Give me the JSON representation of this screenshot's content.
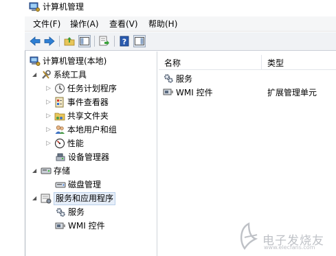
{
  "window": {
    "title": "计算机管理"
  },
  "menu": [
    "文件(F)",
    "操作(A)",
    "查看(V)",
    "帮助(H)"
  ],
  "tree": {
    "root": "计算机管理(本地)",
    "system_tools": "系统工具",
    "task_scheduler": "任务计划程序",
    "event_viewer": "事件查看器",
    "shared_folders": "共享文件夹",
    "local_users": "本地用户和组",
    "performance": "性能",
    "device_manager": "设备管理器",
    "storage": "存储",
    "disk_management": "磁盘管理",
    "services_apps": "服务和应用程序",
    "services": "服务",
    "wmi": "WMI 控件"
  },
  "list": {
    "columns": [
      "名称",
      "类型"
    ],
    "rows": [
      {
        "name": "服务",
        "type": ""
      },
      {
        "name": "WMI 控件",
        "type": "扩展管理单元"
      }
    ]
  },
  "watermark": {
    "text": "电子发烧友",
    "url": "www.elecfans.com"
  }
}
